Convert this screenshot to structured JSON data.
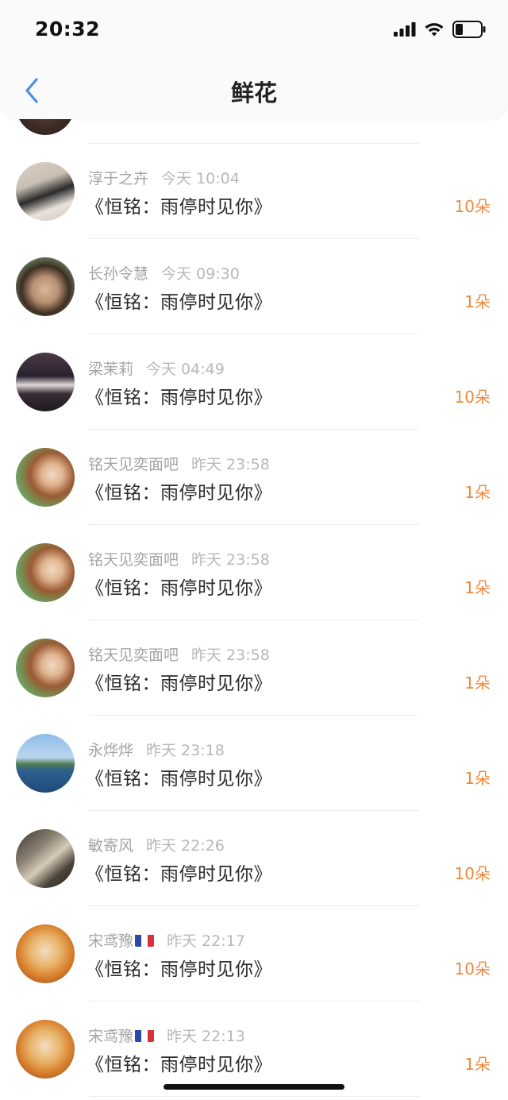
{
  "status": {
    "time": "20:32"
  },
  "nav": {
    "title": "鲜花"
  },
  "colors": {
    "accent_blue": "#4a90e2",
    "count_orange": "#ef8a3c",
    "meta_gray": "#a4a4a4"
  },
  "items": [
    {
      "name": "淳于之卉",
      "time": "今天 10:04",
      "title": "《恒铭：雨停时见你》",
      "count": "10朵",
      "avatar": "photo-girl-room"
    },
    {
      "name": "长孙令慧",
      "time": "今天 09:30",
      "title": "《恒铭：雨停时见你》",
      "count": "1朵",
      "avatar": "photo-child"
    },
    {
      "name": "梁茉莉",
      "time": "今天 04:49",
      "title": "《恒铭：雨停时见你》",
      "count": "10朵",
      "avatar": "photo-man-dark"
    },
    {
      "name": "铭天见奕面吧",
      "time": "昨天 23:58",
      "title": "《恒铭：雨停时见你》",
      "count": "1朵",
      "avatar": "photo-girl-hair"
    },
    {
      "name": "铭天见奕面吧",
      "time": "昨天 23:58",
      "title": "《恒铭：雨停时见你》",
      "count": "1朵",
      "avatar": "photo-girl-hair"
    },
    {
      "name": "铭天见奕面吧",
      "time": "昨天 23:58",
      "title": "《恒铭：雨停时见你》",
      "count": "1朵",
      "avatar": "photo-girl-hair"
    },
    {
      "name": "永烨烨",
      "time": "昨天 23:18",
      "title": "《恒铭：雨停时见你》",
      "count": "1朵",
      "avatar": "photo-landscape"
    },
    {
      "name": "敏寄风",
      "time": "昨天 22:26",
      "title": "《恒铭：雨停时见你》",
      "count": "10朵",
      "avatar": "photo-couple"
    },
    {
      "name": "宋鸢豫",
      "flag": "france-flag",
      "time": "昨天 22:17",
      "title": "《恒铭：雨停时见你》",
      "count": "10朵",
      "avatar": "illustration-girl"
    },
    {
      "name": "宋鸢豫",
      "flag": "france-flag",
      "time": "昨天 22:13",
      "title": "《恒铭：雨停时见你》",
      "count": "1朵",
      "avatar": "illustration-girl"
    }
  ]
}
